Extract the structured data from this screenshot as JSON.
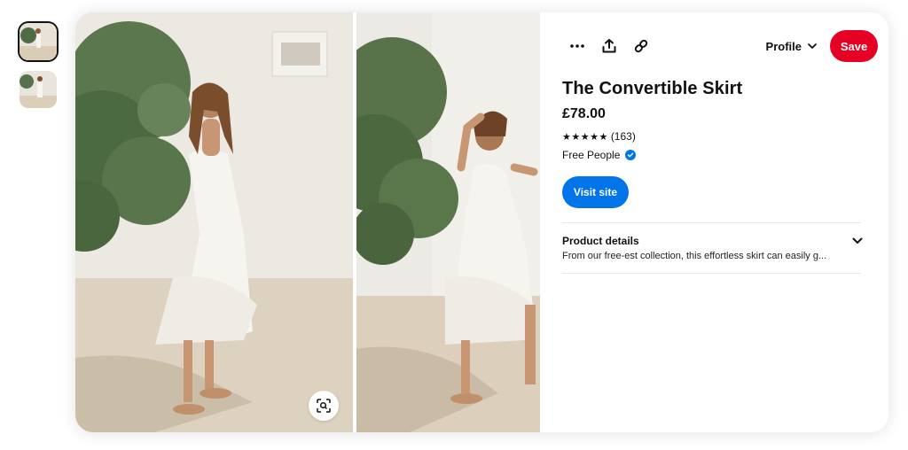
{
  "colors": {
    "save_red": "#e60023",
    "visit_blue": "#0074e8",
    "text": "#111111"
  },
  "thumbnails": [
    {
      "name": "thumbnail-1",
      "active": true
    },
    {
      "name": "thumbnail-2",
      "active": false
    }
  ],
  "toolbar": {
    "more_icon": "ellipsis-icon",
    "share_icon": "share-upload-icon",
    "link_icon": "link-icon",
    "profile_label": "Profile",
    "profile_chevron": "chevron-down-icon",
    "save_label": "Save"
  },
  "product": {
    "title": "The Convertible Skirt",
    "price": "£78.00",
    "stars": "★★★★★",
    "rating_count": "(163)",
    "merchant": "Free People",
    "merchant_verified_icon": "verified-check-icon",
    "visit_label": "Visit site",
    "details_heading": "Product details",
    "details_text": "From our free-est collection, this effortless skirt can easily g..."
  },
  "visual_search_icon": "lens-search-icon"
}
